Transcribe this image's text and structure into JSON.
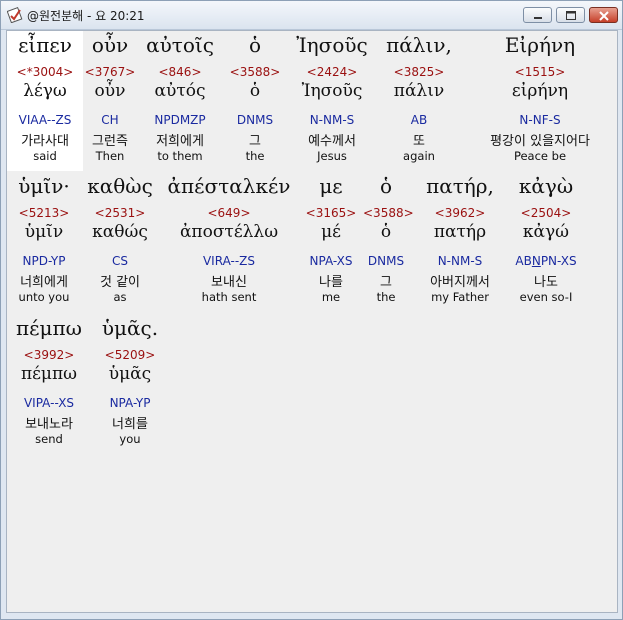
{
  "window": {
    "title": "@원전분해 - 요 20:21",
    "icon": "document-check-icon"
  },
  "lines": [
    {
      "words": [
        {
          "greek": "εἶπεν",
          "strong": "<*3004>",
          "lemma": "λέγω",
          "morph": "VIAA--ZS",
          "korean": "가라사대",
          "english": "said",
          "selected": true
        },
        {
          "greek": "οὖν",
          "strong": "<3767>",
          "lemma": "οὖν",
          "morph": "CH",
          "korean": "그런즉",
          "english": "Then"
        },
        {
          "greek": "αὐτοῖς",
          "strong": "<846>",
          "lemma": "αὐτός",
          "morph": "NPDMZP",
          "korean": "저희에게",
          "english": "to them"
        },
        {
          "greek": "ὁ",
          "strong": "<3588>",
          "lemma": "ὁ",
          "morph": "DNMS",
          "korean": "그",
          "english": "the"
        },
        {
          "greek": "Ἰησοῦς",
          "strong": "<2424>",
          "lemma": "Ἰησοῦς",
          "morph": "N-NM-S",
          "korean": "예수께서",
          "english": "Jesus"
        },
        {
          "greek": "πάλιν,",
          "strong": "<3825>",
          "lemma": "πάλιν",
          "morph": "AB",
          "korean": "또",
          "english": "again"
        },
        {
          "greek": "Εἰρήνη",
          "strong": "<1515>",
          "lemma": "εἰρήνη",
          "morph": "N-NF-S",
          "korean": "평강이 있을지어다",
          "english": "Peace be"
        }
      ]
    },
    {
      "words": [
        {
          "greek": "ὑμῖν·",
          "strong": "<5213>",
          "lemma": "ὑμῖν",
          "morph": "NPD-YP",
          "korean": "너희에게",
          "english": "unto you"
        },
        {
          "greek": "καθὼς",
          "strong": "<2531>",
          "lemma": "καθώς",
          "morph": "CS",
          "korean": "것 같이",
          "english": "as"
        },
        {
          "greek": "ἀπέσταλκέν",
          "strong": "<649>",
          "lemma": "ἀποστέλλω",
          "morph": "VIRA--ZS",
          "korean": "보내신",
          "english": "hath sent"
        },
        {
          "greek": "με",
          "strong": "<3165>",
          "lemma": "μέ",
          "morph": "NPA-XS",
          "korean": "나를",
          "english": "me"
        },
        {
          "greek": "ὁ",
          "strong": "<3588>",
          "lemma": "ὁ",
          "morph": "DNMS",
          "korean": "그",
          "english": "the"
        },
        {
          "greek": "πατήρ,",
          "strong": "<3962>",
          "lemma": "πατήρ",
          "morph": "N-NM-S",
          "korean": "아버지께서",
          "english": "my Father"
        },
        {
          "greek": "κἀγὼ",
          "strong": "<2504>",
          "lemma": "κἀγώ",
          "morph": "ABNPN-XS",
          "korean": "나도",
          "english": "even so-I"
        }
      ]
    },
    {
      "words": [
        {
          "greek": "πέμπω",
          "strong": "<3992>",
          "lemma": "πέμπω",
          "morph": "VIPA--XS",
          "korean": "보내노라",
          "english": "send"
        },
        {
          "greek": "ὑμᾶς.",
          "strong": "<5209>",
          "lemma": "ὑμᾶς",
          "morph": "NPA-YP",
          "korean": "너희를",
          "english": "you"
        }
      ]
    }
  ]
}
